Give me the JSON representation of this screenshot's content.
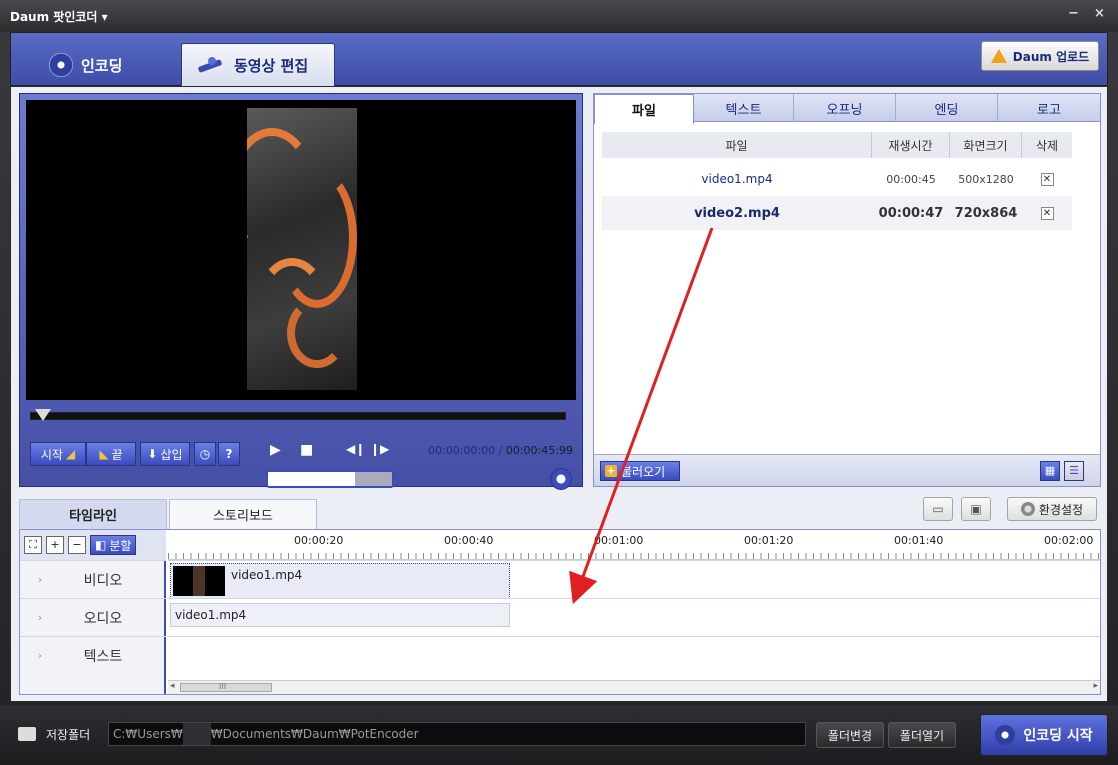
{
  "window": {
    "title": "Daum 팟인코더",
    "dropdown_icon": "chevron-down-icon",
    "minimize": "−",
    "close": "×"
  },
  "top_tabs": {
    "encoding": "인코딩",
    "video_edit": "동영상 편집",
    "active": "video_edit"
  },
  "upload_button": "Daum 업로드",
  "player": {
    "start_label": "시작",
    "end_label": "끝",
    "insert_label": "삽입",
    "help": "?",
    "current_time": "00:00:00:00",
    "separator": "/",
    "total_time": "00:00:45:99",
    "seek_position": 0.0,
    "volume_level": 0.7
  },
  "file_panel": {
    "tabs": [
      "파일",
      "텍스트",
      "오프닝",
      "엔딩",
      "로고"
    ],
    "active_tab": "파일",
    "columns": [
      "파일",
      "재생시간",
      "화면크기",
      "삭제"
    ],
    "rows": [
      {
        "file": "video1.mp4",
        "duration": "00:00:45",
        "size": "500x1280",
        "delete": "✕"
      },
      {
        "file": "video2.mp4",
        "duration": "00:00:47",
        "size": "720x864",
        "delete": "✕"
      }
    ],
    "selected_row": 1,
    "load_button": "불러오기"
  },
  "timeline": {
    "tabs": [
      "타임라인",
      "스토리보드"
    ],
    "active_tab": "타임라인",
    "split_label": "분할",
    "settings_label": "환경설정",
    "ruler": [
      "00:00:20",
      "00:00:40",
      "00:01:00",
      "00:01:20",
      "00:01:40",
      "00:02:00"
    ],
    "tracks": [
      "비디오",
      "오디오",
      "텍스트"
    ],
    "video_clip": "video1.mp4",
    "audio_clip": "video1.mp4",
    "scroll_thumb": "III"
  },
  "bottom": {
    "save_folder_label": "저장폴더",
    "path_prefix": "C:₩Users₩",
    "path_suffix": "₩Documents₩Daum₩PotEncoder",
    "change_folder": "폴더변경",
    "open_folder": "폴더열기",
    "encode_start": "인코딩 시작"
  },
  "colors": {
    "accent": "#3b4cc0",
    "header": "#4a5ab8",
    "arrow": "#e02020",
    "upload_arrow": "#f0a218"
  }
}
